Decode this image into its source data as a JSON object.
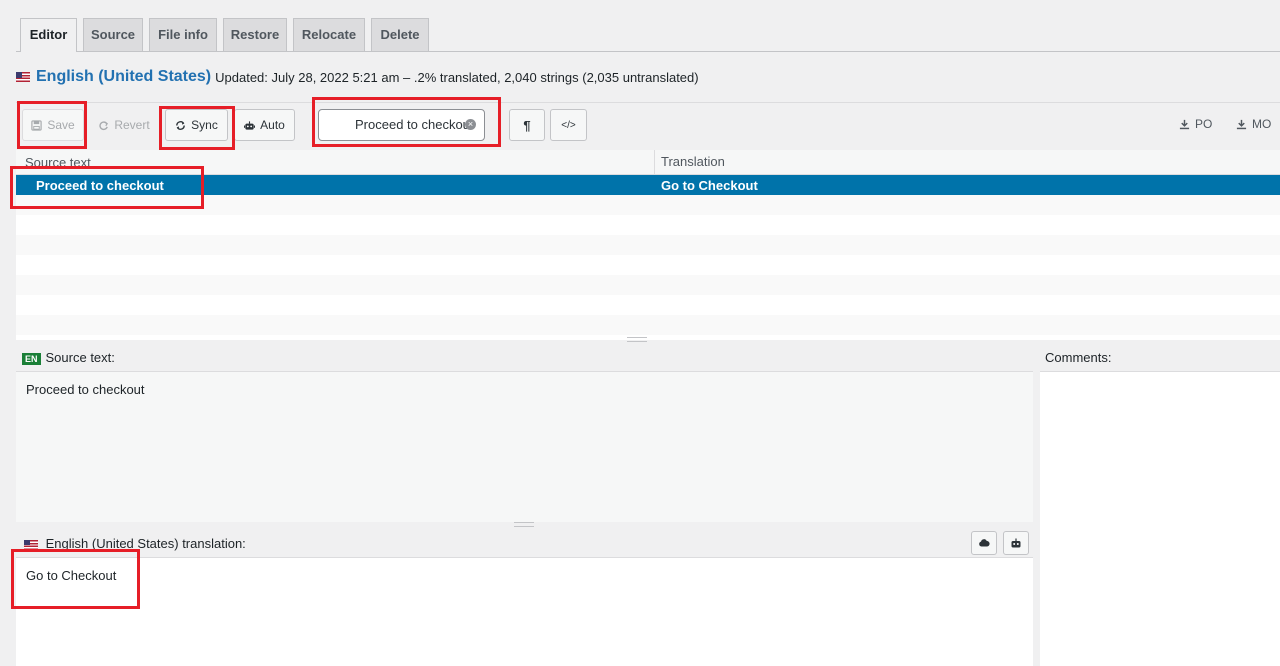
{
  "tabs": [
    "Editor",
    "Source",
    "File info",
    "Restore",
    "Relocate",
    "Delete"
  ],
  "header": {
    "language": "English (United States)",
    "meta": "Updated: July 28, 2022 5:21 am – .2% translated, 2,040 strings (2,035 untranslated)"
  },
  "toolbar": {
    "save": "Save",
    "revert": "Revert",
    "sync": "Sync",
    "auto": "Auto",
    "search_value": "Proceed to checkout",
    "pilcrow": "¶",
    "code": "</>",
    "po": "PO",
    "mo": "MO"
  },
  "grid": {
    "col_source": "Source text",
    "col_translation": "Translation",
    "rows": [
      {
        "source": "Proceed to checkout",
        "translation": "Go to Checkout"
      }
    ]
  },
  "editor": {
    "source_label": "Source text:",
    "source_badge": "EN",
    "source_value": "Proceed to checkout",
    "comments_label": "Comments:",
    "translation_label": "English (United States) translation:",
    "translation_value": "Go to Checkout"
  },
  "colors": {
    "accent": "#2271b1",
    "selected_row": "#0073aa",
    "highlight": "#e61e27"
  },
  "icons": [
    "save-icon",
    "revert-icon",
    "sync-icon",
    "robot-icon",
    "clear-search-icon",
    "download-icon",
    "cloud-icon",
    "us-flag-icon"
  ]
}
